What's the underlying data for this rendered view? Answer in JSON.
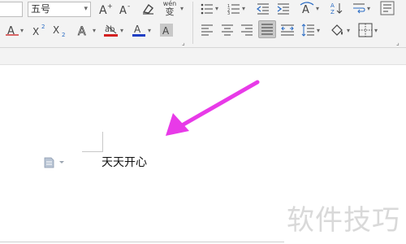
{
  "ribbon": {
    "font_size_value": "五号",
    "dropdown_arrow": "▾",
    "pinyin_label": "wén",
    "pinyin_char": "变"
  },
  "document": {
    "text": "天天开心"
  },
  "watermark": "软件技巧",
  "annotation": {
    "arrow_color": "#e83ae8"
  },
  "icons": [
    "increase-font-icon",
    "decrease-font-icon",
    "clear-format-icon",
    "phonetic-guide-icon",
    "bullet-list-icon",
    "numbered-list-icon",
    "decrease-indent-icon",
    "increase-indent-icon",
    "text-direction-icon",
    "sort-icon",
    "line-break-icon",
    "show-marks-icon",
    "strikethrough-icon",
    "superscript-icon",
    "subscript-icon",
    "text-effect-icon",
    "highlight-icon",
    "font-color-icon",
    "char-shading-icon",
    "align-left-icon",
    "align-center-icon",
    "align-right-icon",
    "justify-icon",
    "distributed-icon",
    "line-spacing-icon",
    "shading-icon",
    "borders-icon"
  ]
}
